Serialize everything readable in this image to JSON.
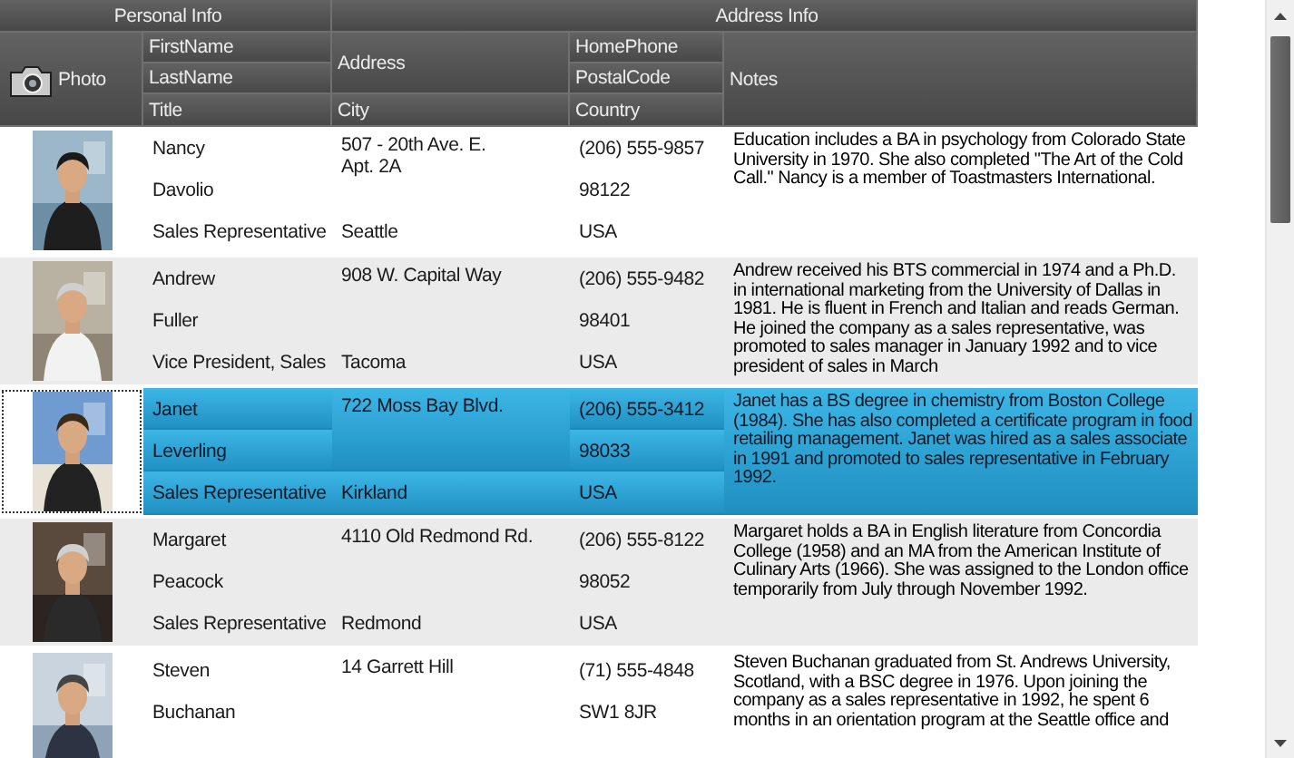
{
  "grid": {
    "column_groups": [
      {
        "label": "Personal Info"
      },
      {
        "label": "Address Info"
      }
    ],
    "columns": {
      "photo": "Photo",
      "first_name": "FirstName",
      "last_name": "LastName",
      "title": "Title",
      "address": "Address",
      "city": "City",
      "home_phone": "HomePhone",
      "postal_code": "PostalCode",
      "country": "Country",
      "notes": "Notes"
    },
    "rows": [
      {
        "first_name": "Nancy",
        "last_name": "Davolio",
        "title": "Sales Representative",
        "address": "507 - 20th Ave. E.\nApt. 2A",
        "city": "Seattle",
        "home_phone": "(206) 555-9857",
        "postal_code": "98122",
        "country": "USA",
        "notes": "Education includes a BA in psychology from Colorado State University in 1970.  She also completed \"The Art of the Cold Call.\"  Nancy is a member of Toastmasters International.",
        "selected": false
      },
      {
        "first_name": "Andrew",
        "last_name": "Fuller",
        "title": "Vice President, Sales",
        "address": "908 W. Capital Way",
        "city": "Tacoma",
        "home_phone": "(206) 555-9482",
        "postal_code": "98401",
        "country": "USA",
        "notes": "Andrew received his BTS commercial in 1974 and a Ph.D. in international marketing from the University of Dallas in 1981.  He is fluent in French and Italian and reads German.  He joined the company as a sales representative, was promoted to sales manager in January 1992 and to vice president of sales in March",
        "selected": false
      },
      {
        "first_name": "Janet",
        "last_name": "Leverling",
        "title": "Sales Representative",
        "address": "722 Moss Bay Blvd.",
        "city": "Kirkland",
        "home_phone": "(206) 555-3412",
        "postal_code": "98033",
        "country": "USA",
        "notes": "Janet has a BS degree in chemistry from Boston College (1984).  She has also completed a certificate program in food retailing management.  Janet was hired as a sales associate in 1991 and promoted to sales representative in February 1992.",
        "selected": true
      },
      {
        "first_name": "Margaret",
        "last_name": "Peacock",
        "title": "Sales Representative",
        "address": "4110 Old Redmond Rd.",
        "city": "Redmond",
        "home_phone": "(206) 555-8122",
        "postal_code": "98052",
        "country": "USA",
        "notes": "Margaret holds a BA in English literature from Concordia College (1958) and an MA from the American Institute of Culinary Arts (1966).  She was assigned to the London office temporarily from July through November 1992.",
        "selected": false
      },
      {
        "first_name": "Steven",
        "last_name": "Buchanan",
        "address": "14 Garrett Hill",
        "home_phone": "(71) 555-4848",
        "postal_code": "SW1 8JR",
        "notes": "Steven Buchanan graduated from St. Andrews University, Scotland, with a BSC degree in 1976.  Upon joining the company as a sales representative in 1992, he spent 6 months in an orientation program at the Seattle office and",
        "selected": false
      }
    ]
  }
}
